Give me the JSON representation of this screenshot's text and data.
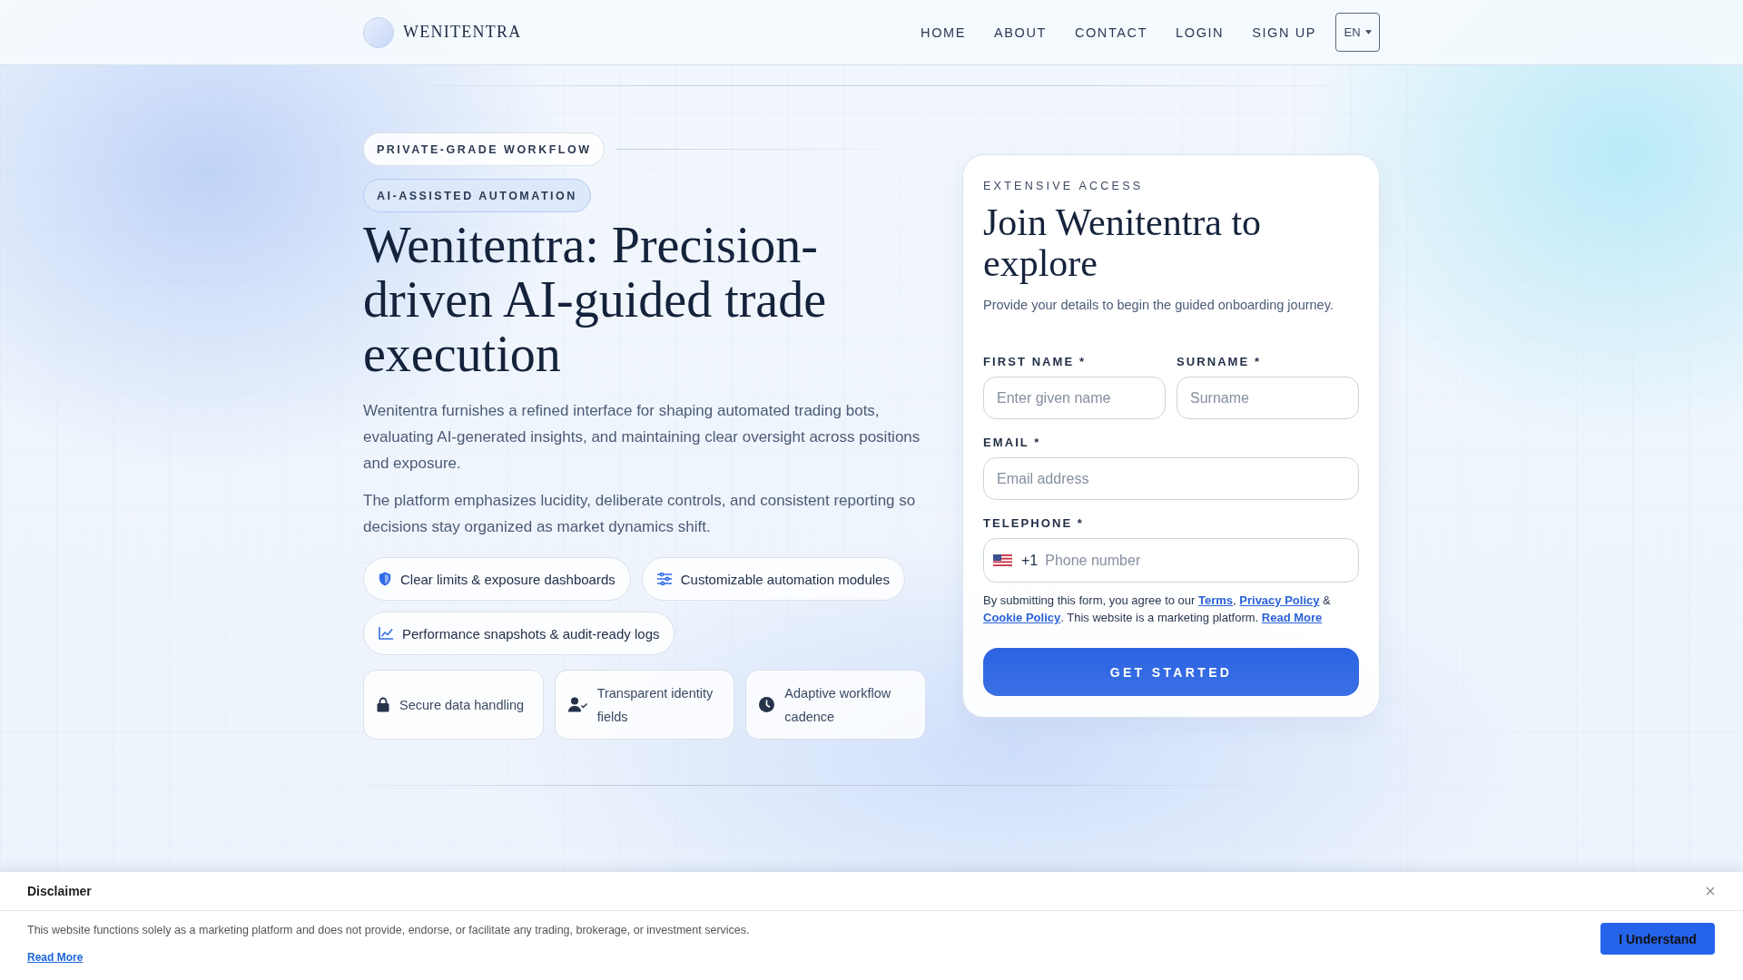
{
  "header": {
    "brand": "WENITENTRA",
    "nav": [
      "HOME",
      "ABOUT",
      "CONTACT",
      "LOGIN",
      "SIGN UP"
    ],
    "language": "EN"
  },
  "hero": {
    "badges": [
      {
        "label": "PRIVATE-GRADE WORKFLOW",
        "kind": "outline"
      },
      {
        "label": "AI-ASSISTED AUTOMATION",
        "kind": "tinted"
      }
    ],
    "title": "Wenitentra: Precision-driven AI-guided trade execution",
    "paragraphs": [
      "Wenitentra furnishes a refined interface for shaping automated trading bots, evaluating AI-generated insights, and maintaining clear oversight across positions and exposure.",
      "The platform emphasizes lucidity, deliberate controls, and consistent reporting so decisions stay organized as market dynamics shift."
    ],
    "feature_chips": [
      "Clear limits & exposure dashboards",
      "Customizable automation modules",
      "Performance snapshots & audit-ready logs"
    ],
    "highlights": [
      "Secure data handling",
      "Transparent identity fields",
      "Adaptive workflow cadence"
    ]
  },
  "signup": {
    "eyebrow": "EXTENSIVE ACCESS",
    "title": "Join Wenitentra to explore",
    "subtitle": "Provide your details to begin the guided onboarding journey.",
    "field_rows": [
      [
        {
          "kind": "text",
          "label": "FIRST NAME *",
          "placeholder": "Enter given name"
        },
        {
          "kind": "text",
          "label": "SURNAME *",
          "placeholder": "Surname"
        }
      ],
      [
        {
          "kind": "text",
          "label": "EMAIL *",
          "placeholder": "Email address"
        }
      ],
      [
        {
          "kind": "phone",
          "label": "TELEPHONE *",
          "dial_code": "+1",
          "placeholder": "Phone number"
        }
      ]
    ],
    "consent": [
      {
        "kind": "text",
        "text": "By submitting this form, you agree to our "
      },
      {
        "kind": "link",
        "text": "Terms"
      },
      {
        "kind": "text",
        "text": ", "
      },
      {
        "kind": "link",
        "text": "Privacy Policy"
      },
      {
        "kind": "text",
        "text": " & "
      },
      {
        "kind": "link",
        "text": "Cookie Policy"
      },
      {
        "kind": "text",
        "text": ". This website is a marketing platform. "
      },
      {
        "kind": "link",
        "text": "Read More"
      }
    ],
    "button": "GET STARTED"
  },
  "disclaimer": {
    "title": "Disclaimer",
    "text": "This website functions solely as a marketing platform and does not provide, endorse, or facilitate any trading, brokerage, or investment services.",
    "link": "Read More",
    "button": "I Understand"
  }
}
